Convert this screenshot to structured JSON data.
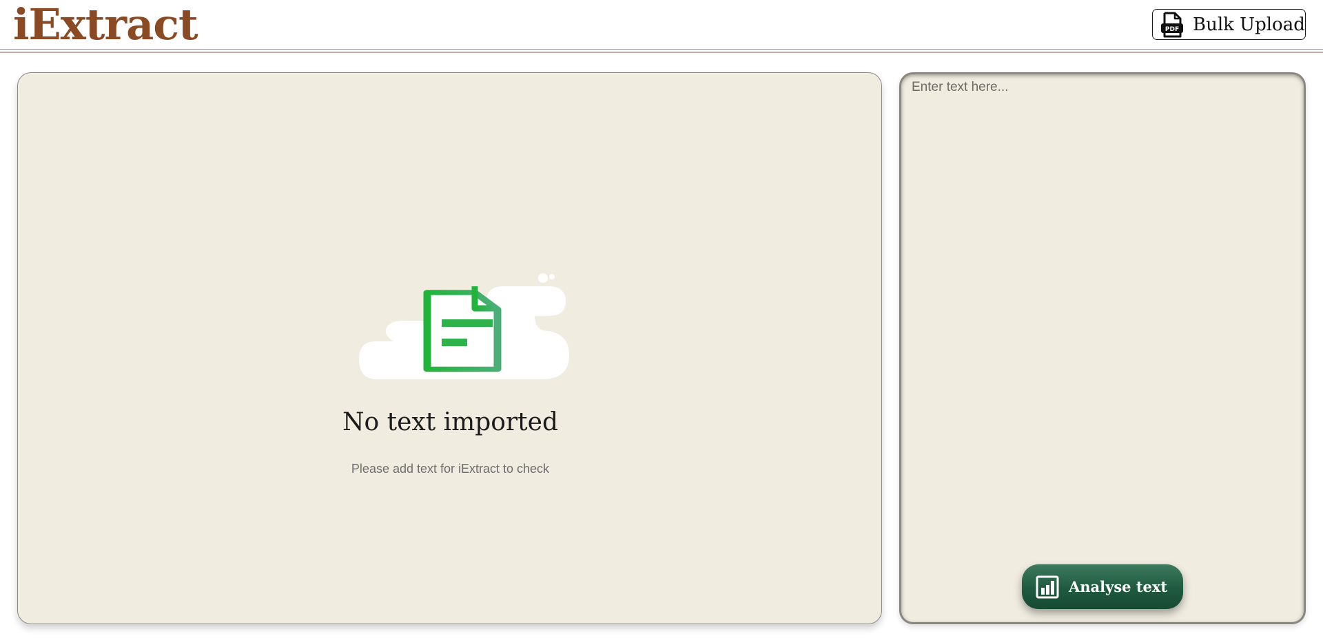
{
  "app": {
    "logo": "iExtract"
  },
  "header": {
    "bulk_upload_label": "Bulk Upload",
    "bulk_upload_icon": "pdf-file-icon"
  },
  "empty_state": {
    "icon": "document-icon",
    "title": "No text imported",
    "subtitle": "Please add text for iExtract to check"
  },
  "editor": {
    "placeholder": "Enter text here...",
    "value": ""
  },
  "actions": {
    "analyse_label": "Analyse text",
    "analyse_icon": "bar-chart-icon"
  },
  "colors": {
    "brand": "#8a4a24",
    "panel_bg": "#f0ece0",
    "doc_green_start": "#21b33a",
    "doc_green_end": "#4caf78",
    "button_green": "#1f5a3e"
  }
}
